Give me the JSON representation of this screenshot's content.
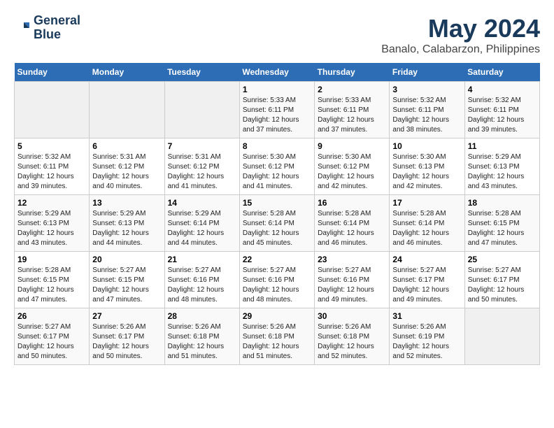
{
  "logo": {
    "line1": "General",
    "line2": "Blue"
  },
  "header": {
    "month": "May 2024",
    "location": "Banalo, Calabarzon, Philippines"
  },
  "weekdays": [
    "Sunday",
    "Monday",
    "Tuesday",
    "Wednesday",
    "Thursday",
    "Friday",
    "Saturday"
  ],
  "weeks": [
    [
      {
        "day": "",
        "info": ""
      },
      {
        "day": "",
        "info": ""
      },
      {
        "day": "",
        "info": ""
      },
      {
        "day": "1",
        "info": "Sunrise: 5:33 AM\nSunset: 6:11 PM\nDaylight: 12 hours\nand 37 minutes."
      },
      {
        "day": "2",
        "info": "Sunrise: 5:33 AM\nSunset: 6:11 PM\nDaylight: 12 hours\nand 37 minutes."
      },
      {
        "day": "3",
        "info": "Sunrise: 5:32 AM\nSunset: 6:11 PM\nDaylight: 12 hours\nand 38 minutes."
      },
      {
        "day": "4",
        "info": "Sunrise: 5:32 AM\nSunset: 6:11 PM\nDaylight: 12 hours\nand 39 minutes."
      }
    ],
    [
      {
        "day": "5",
        "info": "Sunrise: 5:32 AM\nSunset: 6:11 PM\nDaylight: 12 hours\nand 39 minutes."
      },
      {
        "day": "6",
        "info": "Sunrise: 5:31 AM\nSunset: 6:12 PM\nDaylight: 12 hours\nand 40 minutes."
      },
      {
        "day": "7",
        "info": "Sunrise: 5:31 AM\nSunset: 6:12 PM\nDaylight: 12 hours\nand 41 minutes."
      },
      {
        "day": "8",
        "info": "Sunrise: 5:30 AM\nSunset: 6:12 PM\nDaylight: 12 hours\nand 41 minutes."
      },
      {
        "day": "9",
        "info": "Sunrise: 5:30 AM\nSunset: 6:12 PM\nDaylight: 12 hours\nand 42 minutes."
      },
      {
        "day": "10",
        "info": "Sunrise: 5:30 AM\nSunset: 6:13 PM\nDaylight: 12 hours\nand 42 minutes."
      },
      {
        "day": "11",
        "info": "Sunrise: 5:29 AM\nSunset: 6:13 PM\nDaylight: 12 hours\nand 43 minutes."
      }
    ],
    [
      {
        "day": "12",
        "info": "Sunrise: 5:29 AM\nSunset: 6:13 PM\nDaylight: 12 hours\nand 43 minutes."
      },
      {
        "day": "13",
        "info": "Sunrise: 5:29 AM\nSunset: 6:13 PM\nDaylight: 12 hours\nand 44 minutes."
      },
      {
        "day": "14",
        "info": "Sunrise: 5:29 AM\nSunset: 6:14 PM\nDaylight: 12 hours\nand 44 minutes."
      },
      {
        "day": "15",
        "info": "Sunrise: 5:28 AM\nSunset: 6:14 PM\nDaylight: 12 hours\nand 45 minutes."
      },
      {
        "day": "16",
        "info": "Sunrise: 5:28 AM\nSunset: 6:14 PM\nDaylight: 12 hours\nand 46 minutes."
      },
      {
        "day": "17",
        "info": "Sunrise: 5:28 AM\nSunset: 6:14 PM\nDaylight: 12 hours\nand 46 minutes."
      },
      {
        "day": "18",
        "info": "Sunrise: 5:28 AM\nSunset: 6:15 PM\nDaylight: 12 hours\nand 47 minutes."
      }
    ],
    [
      {
        "day": "19",
        "info": "Sunrise: 5:28 AM\nSunset: 6:15 PM\nDaylight: 12 hours\nand 47 minutes."
      },
      {
        "day": "20",
        "info": "Sunrise: 5:27 AM\nSunset: 6:15 PM\nDaylight: 12 hours\nand 47 minutes."
      },
      {
        "day": "21",
        "info": "Sunrise: 5:27 AM\nSunset: 6:16 PM\nDaylight: 12 hours\nand 48 minutes."
      },
      {
        "day": "22",
        "info": "Sunrise: 5:27 AM\nSunset: 6:16 PM\nDaylight: 12 hours\nand 48 minutes."
      },
      {
        "day": "23",
        "info": "Sunrise: 5:27 AM\nSunset: 6:16 PM\nDaylight: 12 hours\nand 49 minutes."
      },
      {
        "day": "24",
        "info": "Sunrise: 5:27 AM\nSunset: 6:17 PM\nDaylight: 12 hours\nand 49 minutes."
      },
      {
        "day": "25",
        "info": "Sunrise: 5:27 AM\nSunset: 6:17 PM\nDaylight: 12 hours\nand 50 minutes."
      }
    ],
    [
      {
        "day": "26",
        "info": "Sunrise: 5:27 AM\nSunset: 6:17 PM\nDaylight: 12 hours\nand 50 minutes."
      },
      {
        "day": "27",
        "info": "Sunrise: 5:26 AM\nSunset: 6:17 PM\nDaylight: 12 hours\nand 50 minutes."
      },
      {
        "day": "28",
        "info": "Sunrise: 5:26 AM\nSunset: 6:18 PM\nDaylight: 12 hours\nand 51 minutes."
      },
      {
        "day": "29",
        "info": "Sunrise: 5:26 AM\nSunset: 6:18 PM\nDaylight: 12 hours\nand 51 minutes."
      },
      {
        "day": "30",
        "info": "Sunrise: 5:26 AM\nSunset: 6:18 PM\nDaylight: 12 hours\nand 52 minutes."
      },
      {
        "day": "31",
        "info": "Sunrise: 5:26 AM\nSunset: 6:19 PM\nDaylight: 12 hours\nand 52 minutes."
      },
      {
        "day": "",
        "info": ""
      }
    ]
  ]
}
